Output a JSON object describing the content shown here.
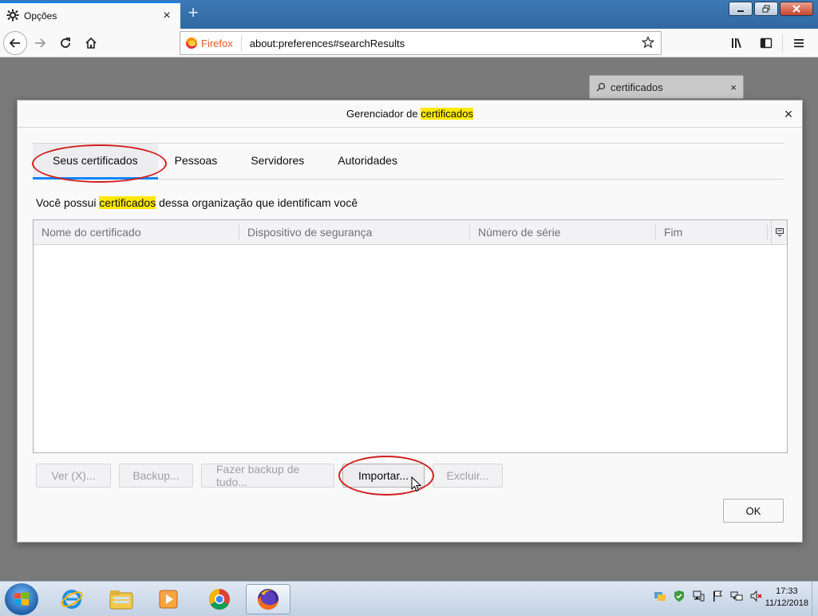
{
  "browser": {
    "tab_title": "Opções",
    "tab_close": "×",
    "new_tab": "+",
    "identity_label": "Firefox",
    "url": "about:preferences#searchResults"
  },
  "search": {
    "value": "certificados",
    "clear": "×"
  },
  "dialog": {
    "title_prefix": "Gerenciador de ",
    "title_highlight": "certificados",
    "close": "×",
    "tabs": [
      {
        "label": "Seus certificados",
        "active": true
      },
      {
        "label": "Pessoas",
        "active": false
      },
      {
        "label": "Servidores",
        "active": false
      },
      {
        "label": "Autoridades",
        "active": false
      }
    ],
    "description_prefix": "Você possui ",
    "description_highlight": "certificados",
    "description_suffix": " dessa organização que identificam você",
    "columns": [
      "Nome do certificado",
      "Dispositivo de segurança",
      "Número de série",
      "Fim"
    ],
    "buttons": {
      "view": "Ver (X)...",
      "backup": "Backup...",
      "backup_all": "Fazer backup de tudo...",
      "import": "Importar...",
      "delete": "Excluir..."
    },
    "ok": "OK"
  },
  "taskbar": {
    "time": "17:33",
    "date": "11/12/2018"
  },
  "colors": {
    "accent": "#0a84ff",
    "highlight": "#ffe900",
    "annotation": "#d21f1f"
  }
}
